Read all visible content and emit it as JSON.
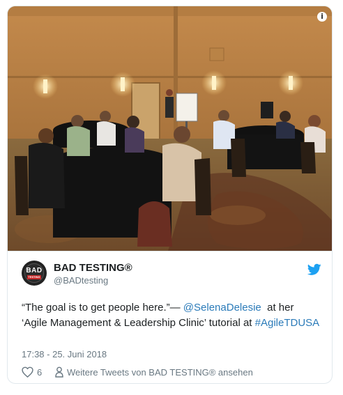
{
  "tweet": {
    "display_name": "BAD TESTING®",
    "handle": "@BADtesting",
    "text_segments": [
      {
        "type": "text",
        "value": "“The goal is to get people here.”— "
      },
      {
        "type": "mention",
        "value": "@SelenaDelesie"
      },
      {
        "type": "text",
        "value": "  at her ‘Agile Management & Leadership Clinic’ tutorial at "
      },
      {
        "type": "hashtag",
        "value": "#AgileTDUSA"
      }
    ],
    "timestamp": "17:38 - 25. Juni 2018",
    "like_count": "6",
    "more_tweets_label": "Weitere Tweets von BAD TESTING® ansehen"
  },
  "avatar": {
    "logo_top": "BAD",
    "logo_bottom": "TESTING"
  },
  "icons": {
    "info": "info-icon",
    "twitter": "twitter-bird-icon",
    "heart": "heart-icon",
    "person": "person-icon"
  },
  "colors": {
    "link": "#2b7bb9",
    "twitter_blue": "#1da1f2",
    "text": "#1c2022",
    "muted": "#697882"
  }
}
